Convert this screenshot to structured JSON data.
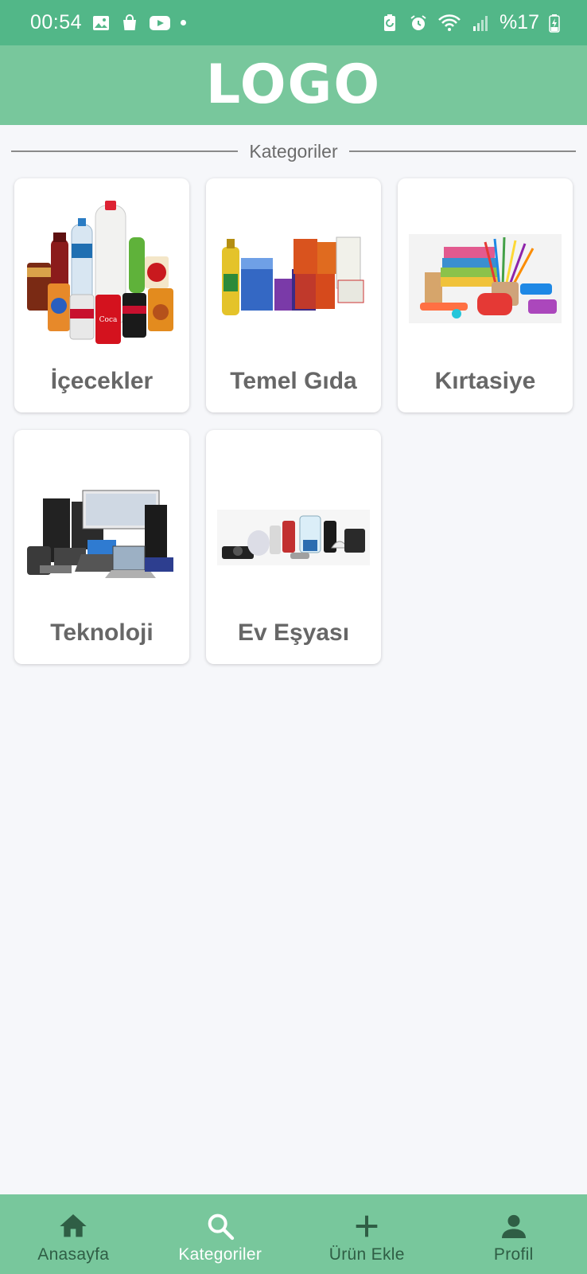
{
  "status_bar": {
    "time": "00:54",
    "battery": "%17",
    "left_icons": [
      "image-icon",
      "shopping-bag-icon",
      "youtube-icon",
      "dot-icon"
    ],
    "right_icons": [
      "battery-saver-icon",
      "alarm-icon",
      "wifi-icon",
      "signal-icon",
      "battery-charging-icon"
    ]
  },
  "header": {
    "logo": "LOGO"
  },
  "section": {
    "title": "Kategoriler"
  },
  "categories": [
    {
      "label": "İçecekler",
      "icon": "beverages-image"
    },
    {
      "label": "Temel Gıda",
      "icon": "staple-food-image"
    },
    {
      "label": "Kırtasiye",
      "icon": "stationery-image"
    },
    {
      "label": "Teknoloji",
      "icon": "technology-image"
    },
    {
      "label": "Ev Eşyası",
      "icon": "home-appliances-image"
    }
  ],
  "bottom_nav": {
    "items": [
      {
        "label": "Anasayfa",
        "icon": "home-icon"
      },
      {
        "label": "Kategoriler",
        "icon": "search-icon"
      },
      {
        "label": "Ürün Ekle",
        "icon": "plus-icon"
      },
      {
        "label": "Profil",
        "icon": "person-icon"
      }
    ]
  },
  "colors": {
    "status_bar": "#52b788",
    "header": "#78c79c",
    "nav": "#78c79c",
    "background": "#f6f7fa",
    "nav_active": "#ffffff",
    "nav_inactive": "#2f5e45"
  }
}
